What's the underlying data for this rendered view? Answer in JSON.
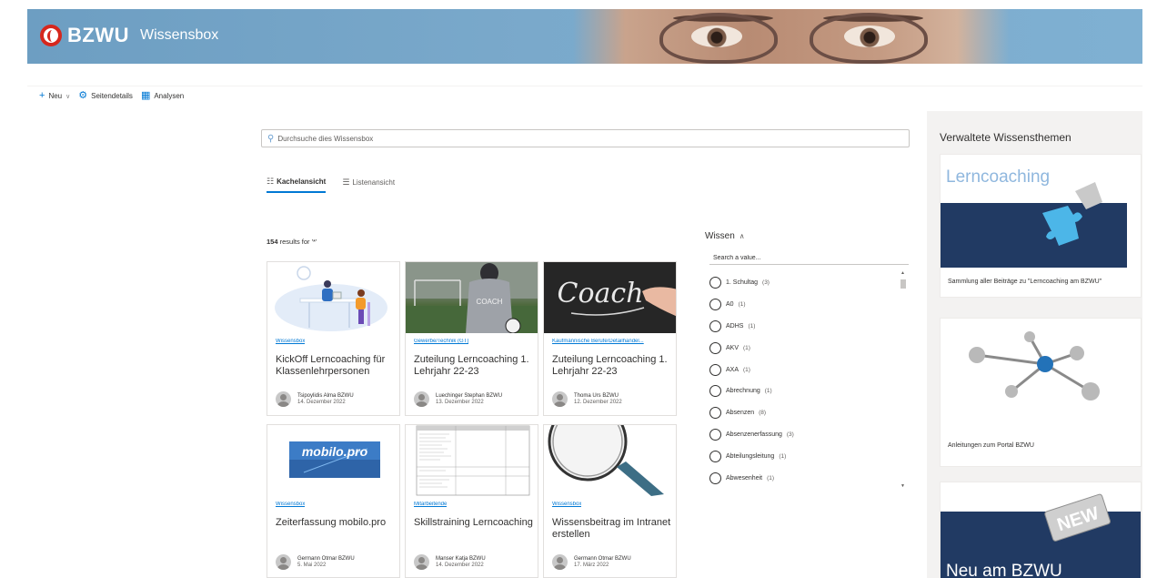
{
  "header": {
    "logo_text": "BZWU",
    "site_title": "Wissensbox"
  },
  "command_bar": {
    "new_label": "Neu",
    "page_details_label": "Seitendetails",
    "analytics_label": "Analysen"
  },
  "search": {
    "placeholder": "Durchsuche dies Wissensbox"
  },
  "view_tabs": {
    "tiles_label": "Kachelansicht",
    "list_label": "Listenansicht"
  },
  "results": {
    "count": "154",
    "suffix": "results for '*'"
  },
  "cards": [
    {
      "category": "Wissensbox",
      "title": "KickOff Lerncoaching für Klassenlehrpersonen",
      "author": "Tsipoylidis Alma BZWU",
      "date": "14. Dezember 2022"
    },
    {
      "category": "Gewerbe/Technik (GT)",
      "title": "Zuteilung Lerncoaching 1. Lehrjahr 22-23",
      "author": "Luechinger Stephan BZWU",
      "date": "13. Dezember 2022"
    },
    {
      "category": "Kaufmännische Berufe/Detailhandel...",
      "title": "Zuteilung Lerncoaching 1. Lehrjahr 22-23",
      "author": "Thoma Urs BZWU",
      "date": "12. Dezember 2022"
    },
    {
      "category": "Wissensbox",
      "title": "Zeiterfassung mobilo.pro",
      "author": "Germann Otmar BZWU",
      "date": "5. Mai 2022"
    },
    {
      "category": "Mitarbeitende",
      "title": "Skillstraining Lerncoaching",
      "author": "Manser Katja BZWU",
      "date": "14. Dezember 2022"
    },
    {
      "category": "Wissensbox",
      "title": "Wissensbeitrag im Intranet erstellen",
      "author": "Germann Otmar BZWU",
      "date": "17. März 2022"
    }
  ],
  "card_images": {
    "coach_text": "COACH",
    "chalk_text": "Coach",
    "mobilo_text": "mobilo.pro"
  },
  "filter": {
    "title": "Wissen",
    "search_placeholder": "Search a value...",
    "options": [
      {
        "label": "1. Schultag",
        "count": "(3)"
      },
      {
        "label": "A0",
        "count": "(1)"
      },
      {
        "label": "ADHS",
        "count": "(1)"
      },
      {
        "label": "AKV",
        "count": "(1)"
      },
      {
        "label": "AXA",
        "count": "(1)"
      },
      {
        "label": "Abrechnung",
        "count": "(1)"
      },
      {
        "label": "Absenzen",
        "count": "(8)"
      },
      {
        "label": "Absenzenerfassung",
        "count": "(3)"
      },
      {
        "label": "Abteilungsleitung",
        "count": "(1)"
      },
      {
        "label": "Abwesenheit",
        "count": "(1)"
      }
    ]
  },
  "sidebar": {
    "title": "Verwaltete Wissensthemen",
    "items": [
      {
        "image_text": "Lerncoaching",
        "caption": "Sammlung aller Beiträge zu \"Lerncoaching am BZWU\""
      },
      {
        "caption": "Anleitungen zum Portal BZWU"
      },
      {
        "badge": "NEW",
        "image_text": "Neu am BZWU"
      }
    ]
  },
  "colors": {
    "accent": "#0078d4",
    "brand_red": "#d6271d",
    "banner_blue": "#7aa9cb",
    "navy": "#243b63"
  }
}
